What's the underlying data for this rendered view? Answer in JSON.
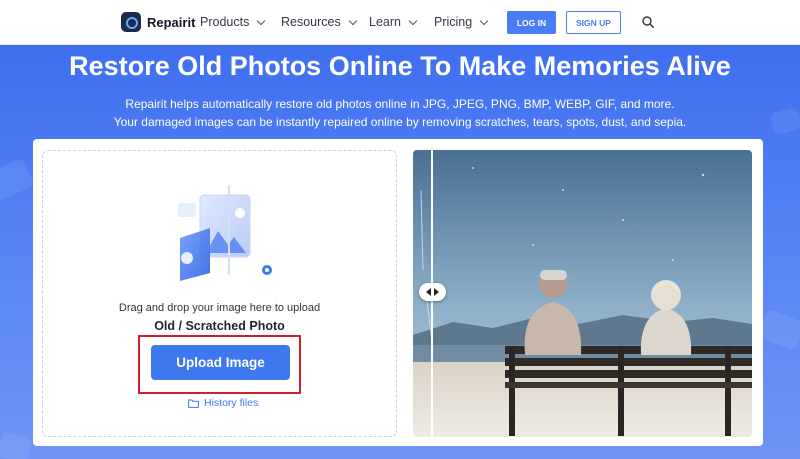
{
  "nav": {
    "brand": "Repairit",
    "items": [
      {
        "label": "Products"
      },
      {
        "label": "Resources"
      },
      {
        "label": "Learn"
      },
      {
        "label": "Pricing"
      }
    ],
    "login_label": "LOG IN",
    "signup_label": "SIGN UP",
    "search_icon": "search-icon"
  },
  "hero": {
    "title": "Restore Old Photos Online To Make Memories Alive",
    "subtitle_line1": "Repairit helps automatically restore old photos online in JPG, JPEG, PNG, BMP, WEBP, GIF, and more.",
    "subtitle_line2": "Your damaged images can be instantly repaired online by removing scratches, tears, spots, dust, and sepia."
  },
  "upload": {
    "drag_text": "Drag and drop your image here to upload",
    "photo_type": "Old / Scratched Photo",
    "button_label": "Upload Image",
    "history_label": "History files"
  },
  "colors": {
    "accent": "#3d78ee",
    "hero_bg": "#4d7cf0",
    "highlight": "#d11f2a"
  }
}
